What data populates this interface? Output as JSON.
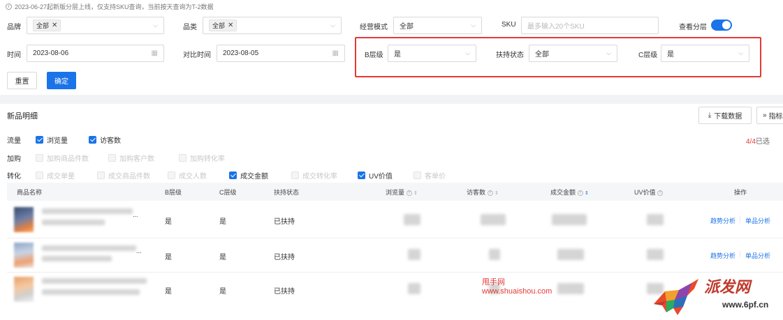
{
  "notice": "2023-06-27起新版分层上线，仅支持SKU查询，当前按天查询为T-2数据",
  "filters": {
    "brand": {
      "label": "品牌",
      "tag": "全部"
    },
    "category": {
      "label": "品类",
      "tag": "全部"
    },
    "mode": {
      "label": "经营模式",
      "value": "全部"
    },
    "sku": {
      "label": "SKU",
      "placeholder": "最多输入20个SKU"
    },
    "layer_toggle": {
      "label": "查看分层",
      "on": true
    },
    "date": {
      "label": "时间",
      "value": "2023-08-06"
    },
    "compare_date": {
      "label": "对比时间",
      "value": "2023-08-05"
    },
    "b_level": {
      "label": "B层级",
      "value": "是"
    },
    "support": {
      "label": "扶持状态",
      "value": "全部"
    },
    "c_level": {
      "label": "C层级",
      "value": "是"
    }
  },
  "buttons": {
    "reset": "重置",
    "confirm": "确定",
    "download": "下载数据",
    "indicator": "指标"
  },
  "section": {
    "title": "新品明细",
    "selected_count": "4/4",
    "selected_suffix": "已选",
    "accent": "#1a73e8",
    "count_color": "#e53935"
  },
  "metric_groups": [
    {
      "label": "流量",
      "options": [
        {
          "label": "浏览量",
          "state": "checked"
        },
        {
          "label": "访客数",
          "state": "checked"
        }
      ]
    },
    {
      "label": "加购",
      "options": [
        {
          "label": "加购商品件数",
          "state": "disabled"
        },
        {
          "label": "加购客户数",
          "state": "disabled"
        },
        {
          "label": "加购转化率",
          "state": "disabled"
        }
      ]
    },
    {
      "label": "转化",
      "options": [
        {
          "label": "成交单量",
          "state": "disabled"
        },
        {
          "label": "成交商品件数",
          "state": "disabled"
        },
        {
          "label": "成交人数",
          "state": "disabled"
        },
        {
          "label": "成交金额",
          "state": "checked"
        },
        {
          "label": "成交转化率",
          "state": "disabled"
        },
        {
          "label": "UV价值",
          "state": "checked"
        },
        {
          "label": "客单价",
          "state": "disabled"
        }
      ]
    }
  ],
  "table": {
    "columns": {
      "name": "商品名称",
      "b_level": "B层级",
      "c_level": "C层级",
      "support": "扶持状态",
      "views": "浏览量",
      "visitors": "访客数",
      "amount": "成交金额",
      "uv_value": "UV价值",
      "actions": "操作"
    },
    "rows": [
      {
        "name_suffix": "...",
        "b_level": "是",
        "c_level": "是",
        "support": "已扶持",
        "trend": "趋势分析",
        "single": "单品分析"
      },
      {
        "name_suffix": "...",
        "b_level": "是",
        "c_level": "是",
        "support": "已扶持",
        "trend": "趋势分析",
        "single": "单品分析"
      },
      {
        "name_suffix": "",
        "b_level": "是",
        "c_level": "是",
        "support": "已扶持",
        "trend": "",
        "single": ""
      }
    ]
  },
  "watermarks": {
    "site_name": "甩手网",
    "site_url": "www.shuaishou.com",
    "logo_text": "派发网",
    "logo_url": "www.6pf.cn"
  }
}
